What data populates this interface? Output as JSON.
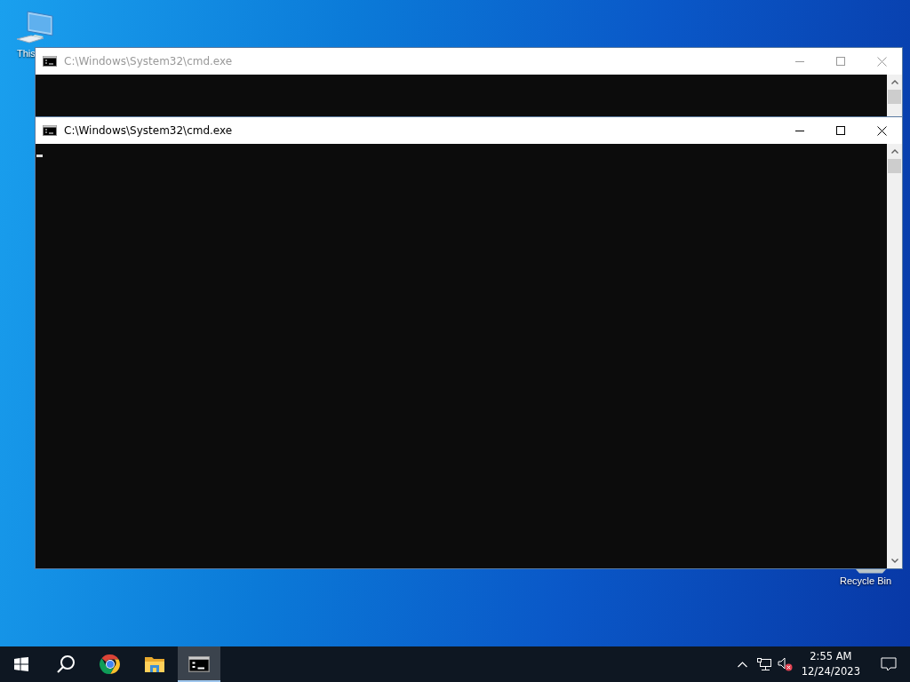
{
  "desktop_icons": [
    {
      "kind": "computer",
      "label": "This"
    },
    {
      "kind": "bin",
      "label": "Recycle Bin"
    }
  ],
  "windows": [
    {
      "title": "C:\\Windows\\System32\\cmd.exe",
      "selected": false
    },
    {
      "title": "C:\\Windows\\System32\\cmd.exe",
      "selected": true
    }
  ],
  "taskbar": {
    "apps": [
      {
        "kind": "chrome",
        "selected": false
      },
      {
        "kind": "explorer",
        "selected": false
      },
      {
        "kind": "cmd",
        "selected": true
      }
    ],
    "clock": {
      "time": "2:55 AM",
      "date": "12/24/2023"
    }
  }
}
